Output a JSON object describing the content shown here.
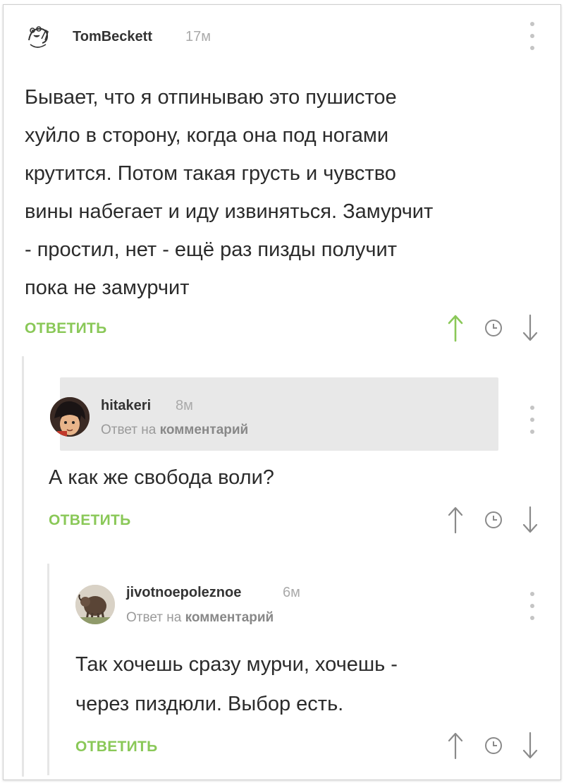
{
  "comments": [
    {
      "username": "TomBeckett",
      "time": "17м",
      "lines": [
        "Бывает, что я отпинываю это пушистое",
        "хуйло в сторону, когда она под ногами",
        "крутится. Потом такая грусть и чувство",
        "вины набегает и иду извиняться. Замурчит",
        "- простил, нет - ещё раз пизды получит",
        "пока не замурчит"
      ],
      "reply_label": "ОТВЕТИТЬ",
      "upvoted": true
    },
    {
      "username": "hitakeri",
      "time": "8м",
      "reply_to_prefix": "Ответ на",
      "reply_to_target": "комментарий",
      "lines": [
        "А как же свобода воли?"
      ],
      "reply_label": "ОТВЕТИТЬ",
      "upvoted": false
    },
    {
      "username": "jivotnoepoleznoe",
      "time": "6м",
      "reply_to_prefix": "Ответ на",
      "reply_to_target": "комментарий",
      "lines": [
        "Так хочешь сразу мурчи, хочешь -",
        "через пиздюли. Выбор есть."
      ],
      "reply_label": "ОТВЕТИТЬ",
      "upvoted": false
    }
  ],
  "icons": {
    "upvote": "arrow-up-icon",
    "clock": "clock-icon",
    "downvote": "arrow-down-icon",
    "more": "more-vertical-icon"
  },
  "colors": {
    "accent_green": "#8ac858",
    "text": "#2b2b2b",
    "muted": "#aaaaaa",
    "icon_gray": "#8a8a8a",
    "highlight_bg": "#e8e8e8"
  }
}
